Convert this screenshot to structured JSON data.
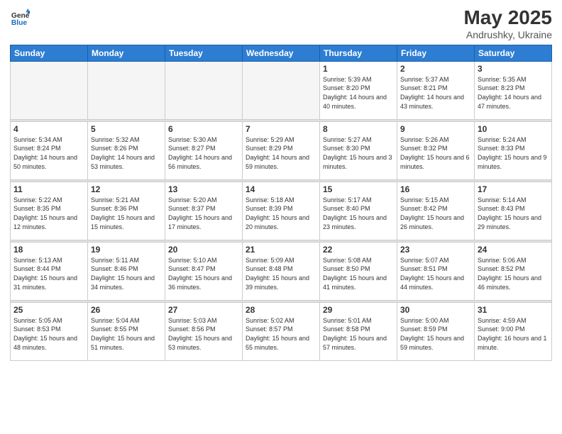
{
  "header": {
    "logo_general": "General",
    "logo_blue": "Blue",
    "month": "May 2025",
    "location": "Andrushky, Ukraine"
  },
  "weekdays": [
    "Sunday",
    "Monday",
    "Tuesday",
    "Wednesday",
    "Thursday",
    "Friday",
    "Saturday"
  ],
  "weeks": [
    [
      {
        "day": "",
        "empty": true
      },
      {
        "day": "",
        "empty": true
      },
      {
        "day": "",
        "empty": true
      },
      {
        "day": "",
        "empty": true
      },
      {
        "day": "1",
        "sunrise": "5:39 AM",
        "sunset": "8:20 PM",
        "daylight": "14 hours and 40 minutes."
      },
      {
        "day": "2",
        "sunrise": "5:37 AM",
        "sunset": "8:21 PM",
        "daylight": "14 hours and 43 minutes."
      },
      {
        "day": "3",
        "sunrise": "5:35 AM",
        "sunset": "8:23 PM",
        "daylight": "14 hours and 47 minutes."
      }
    ],
    [
      {
        "day": "4",
        "sunrise": "5:34 AM",
        "sunset": "8:24 PM",
        "daylight": "14 hours and 50 minutes."
      },
      {
        "day": "5",
        "sunrise": "5:32 AM",
        "sunset": "8:26 PM",
        "daylight": "14 hours and 53 minutes."
      },
      {
        "day": "6",
        "sunrise": "5:30 AM",
        "sunset": "8:27 PM",
        "daylight": "14 hours and 56 minutes."
      },
      {
        "day": "7",
        "sunrise": "5:29 AM",
        "sunset": "8:29 PM",
        "daylight": "14 hours and 59 minutes."
      },
      {
        "day": "8",
        "sunrise": "5:27 AM",
        "sunset": "8:30 PM",
        "daylight": "15 hours and 3 minutes."
      },
      {
        "day": "9",
        "sunrise": "5:26 AM",
        "sunset": "8:32 PM",
        "daylight": "15 hours and 6 minutes."
      },
      {
        "day": "10",
        "sunrise": "5:24 AM",
        "sunset": "8:33 PM",
        "daylight": "15 hours and 9 minutes."
      }
    ],
    [
      {
        "day": "11",
        "sunrise": "5:22 AM",
        "sunset": "8:35 PM",
        "daylight": "15 hours and 12 minutes."
      },
      {
        "day": "12",
        "sunrise": "5:21 AM",
        "sunset": "8:36 PM",
        "daylight": "15 hours and 15 minutes."
      },
      {
        "day": "13",
        "sunrise": "5:20 AM",
        "sunset": "8:37 PM",
        "daylight": "15 hours and 17 minutes."
      },
      {
        "day": "14",
        "sunrise": "5:18 AM",
        "sunset": "8:39 PM",
        "daylight": "15 hours and 20 minutes."
      },
      {
        "day": "15",
        "sunrise": "5:17 AM",
        "sunset": "8:40 PM",
        "daylight": "15 hours and 23 minutes."
      },
      {
        "day": "16",
        "sunrise": "5:15 AM",
        "sunset": "8:42 PM",
        "daylight": "15 hours and 26 minutes."
      },
      {
        "day": "17",
        "sunrise": "5:14 AM",
        "sunset": "8:43 PM",
        "daylight": "15 hours and 29 minutes."
      }
    ],
    [
      {
        "day": "18",
        "sunrise": "5:13 AM",
        "sunset": "8:44 PM",
        "daylight": "15 hours and 31 minutes."
      },
      {
        "day": "19",
        "sunrise": "5:11 AM",
        "sunset": "8:46 PM",
        "daylight": "15 hours and 34 minutes."
      },
      {
        "day": "20",
        "sunrise": "5:10 AM",
        "sunset": "8:47 PM",
        "daylight": "15 hours and 36 minutes."
      },
      {
        "day": "21",
        "sunrise": "5:09 AM",
        "sunset": "8:48 PM",
        "daylight": "15 hours and 39 minutes."
      },
      {
        "day": "22",
        "sunrise": "5:08 AM",
        "sunset": "8:50 PM",
        "daylight": "15 hours and 41 minutes."
      },
      {
        "day": "23",
        "sunrise": "5:07 AM",
        "sunset": "8:51 PM",
        "daylight": "15 hours and 44 minutes."
      },
      {
        "day": "24",
        "sunrise": "5:06 AM",
        "sunset": "8:52 PM",
        "daylight": "15 hours and 46 minutes."
      }
    ],
    [
      {
        "day": "25",
        "sunrise": "5:05 AM",
        "sunset": "8:53 PM",
        "daylight": "15 hours and 48 minutes."
      },
      {
        "day": "26",
        "sunrise": "5:04 AM",
        "sunset": "8:55 PM",
        "daylight": "15 hours and 51 minutes."
      },
      {
        "day": "27",
        "sunrise": "5:03 AM",
        "sunset": "8:56 PM",
        "daylight": "15 hours and 53 minutes."
      },
      {
        "day": "28",
        "sunrise": "5:02 AM",
        "sunset": "8:57 PM",
        "daylight": "15 hours and 55 minutes."
      },
      {
        "day": "29",
        "sunrise": "5:01 AM",
        "sunset": "8:58 PM",
        "daylight": "15 hours and 57 minutes."
      },
      {
        "day": "30",
        "sunrise": "5:00 AM",
        "sunset": "8:59 PM",
        "daylight": "15 hours and 59 minutes."
      },
      {
        "day": "31",
        "sunrise": "4:59 AM",
        "sunset": "9:00 PM",
        "daylight": "16 hours and 1 minute."
      }
    ]
  ]
}
